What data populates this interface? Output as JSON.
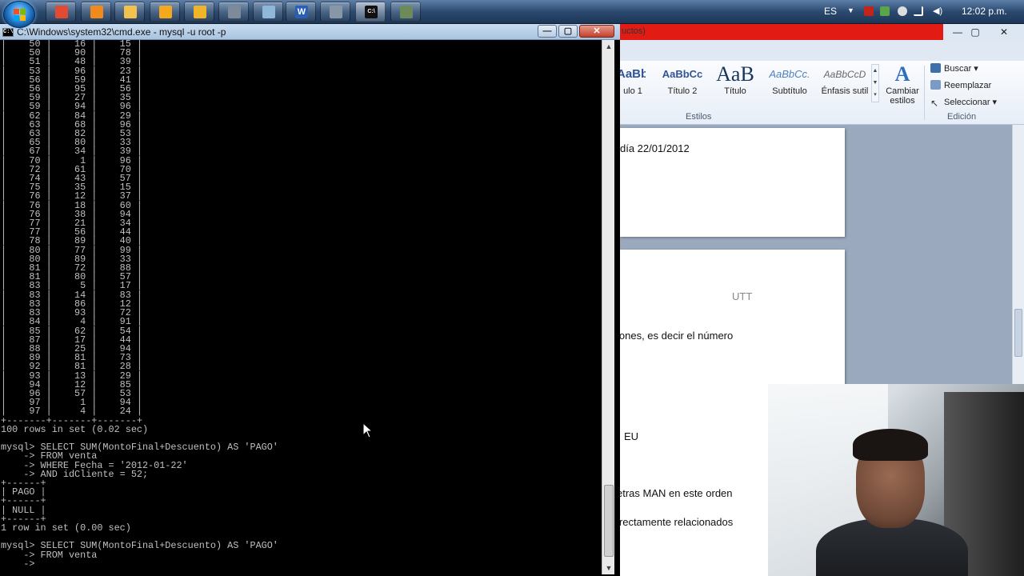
{
  "taskbar": {
    "apps": [
      {
        "name": "chrome",
        "color": "#e24a32"
      },
      {
        "name": "firefox",
        "color": "#f08a1c"
      },
      {
        "name": "explorer",
        "color": "#f2c14e"
      },
      {
        "name": "media-player",
        "color": "#f4a81b"
      },
      {
        "name": "paint",
        "color": "#f0b429"
      },
      {
        "name": "remote",
        "color": "#7d8a99"
      },
      {
        "name": "notepad",
        "color": "#8fb7d8"
      },
      {
        "name": "word",
        "color": "#2b5fb4",
        "glyph": "W"
      },
      {
        "name": "tool",
        "color": "#8797a8"
      },
      {
        "name": "cmd",
        "color": "#111111",
        "glyph": "C:\\"
      },
      {
        "name": "network-tool",
        "color": "#6d8a5a"
      }
    ],
    "tray": {
      "language": "ES",
      "clock": "12:02 p.m."
    }
  },
  "cmd": {
    "title": "C:\\Windows\\system32\\cmd.exe - mysql  -u root -p",
    "controls": {
      "minimize": "—",
      "maximize": "▢",
      "close": "✕"
    },
    "table_rows": [
      [
        "50",
        "16",
        "15"
      ],
      [
        "50",
        "90",
        "78"
      ],
      [
        "51",
        "48",
        "39"
      ],
      [
        "53",
        "96",
        "23"
      ],
      [
        "56",
        "59",
        "41"
      ],
      [
        "56",
        "95",
        "56"
      ],
      [
        "59",
        "27",
        "35"
      ],
      [
        "59",
        "94",
        "96"
      ],
      [
        "62",
        "84",
        "29"
      ],
      [
        "63",
        "68",
        "96"
      ],
      [
        "63",
        "82",
        "53"
      ],
      [
        "65",
        "80",
        "33"
      ],
      [
        "67",
        "34",
        "39"
      ],
      [
        "70",
        "1",
        "96"
      ],
      [
        "72",
        "61",
        "70"
      ],
      [
        "74",
        "43",
        "57"
      ],
      [
        "75",
        "35",
        "15"
      ],
      [
        "76",
        "12",
        "37"
      ],
      [
        "76",
        "18",
        "60"
      ],
      [
        "76",
        "38",
        "94"
      ],
      [
        "77",
        "21",
        "34"
      ],
      [
        "77",
        "56",
        "44"
      ],
      [
        "78",
        "89",
        "40"
      ],
      [
        "80",
        "77",
        "99"
      ],
      [
        "80",
        "89",
        "33"
      ],
      [
        "81",
        "72",
        "88"
      ],
      [
        "81",
        "80",
        "57"
      ],
      [
        "83",
        "5",
        "17"
      ],
      [
        "83",
        "14",
        "83"
      ],
      [
        "83",
        "86",
        "12"
      ],
      [
        "83",
        "93",
        "72"
      ],
      [
        "84",
        "4",
        "91"
      ],
      [
        "85",
        "62",
        "54"
      ],
      [
        "87",
        "17",
        "44"
      ],
      [
        "88",
        "25",
        "94"
      ],
      [
        "89",
        "81",
        "73"
      ],
      [
        "92",
        "81",
        "28"
      ],
      [
        "93",
        "13",
        "29"
      ],
      [
        "94",
        "12",
        "85"
      ],
      [
        "96",
        "57",
        "53"
      ],
      [
        "97",
        "1",
        "94"
      ],
      [
        "97",
        "4",
        "24"
      ]
    ],
    "table_border": "+-------+-------+-------+",
    "result_rows": "100 rows in set (0.02 sec)",
    "query1": [
      "mysql> SELECT SUM(MontoFinal+Descuento) AS 'PAGO'",
      "    -> FROM venta",
      "    -> WHERE Fecha = '2012-01-22'",
      "    -> AND idCliente = 52;"
    ],
    "result_table": [
      "+------+",
      "| PAGO |",
      "+------+",
      "| NULL |",
      "+------+"
    ],
    "result_count": "1 row in set (0.00 sec)",
    "query2": [
      "mysql> SELECT SUM(MontoFinal+Descuento) AS 'PAGO'",
      "    -> FROM venta",
      "    ->"
    ]
  },
  "word": {
    "title_fragment": "uctos)",
    "styles": [
      {
        "sample": "AaBbC",
        "name": "ulo 1"
      },
      {
        "sample": "AaBbCc",
        "name": "Título 2"
      },
      {
        "sample": "AaB",
        "name": "Título"
      },
      {
        "sample": "AaBbCc.",
        "name": "Subtítulo"
      },
      {
        "sample": "AaBbCcD",
        "name": "Énfasis sutil"
      }
    ],
    "change_styles": "Cambiar estilos",
    "styles_group": "Estilos",
    "editing": {
      "find": "Buscar",
      "replace": "Reemplazar",
      "select": "Seleccionar",
      "group": "Edición"
    },
    "doc_lines": {
      "date": "día 22/01/2012",
      "utt": "UTT",
      "line1": "iones, es decir el número",
      "eu": "EU",
      "line2": "etras MAN en este orden",
      "line3": "irectamente relacionados"
    }
  }
}
